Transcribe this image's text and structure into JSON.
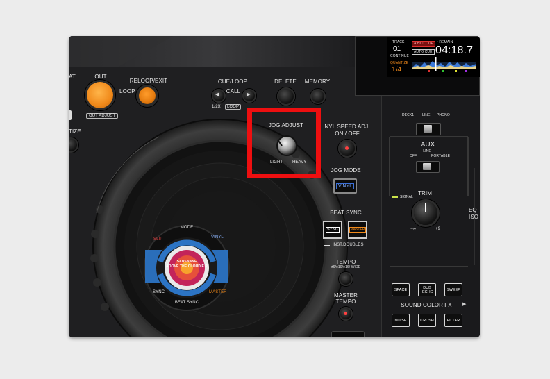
{
  "screen": {
    "track_label": "TRACK",
    "track_no": "01",
    "continue_label": "CONTINUE",
    "hot_cue_badge": "A.HOT CUE",
    "auto_cue_badge": "AUTO CUE",
    "remain_label": "• REMAIN",
    "time": "04:18.7",
    "quantize_label": "QUANTIZE",
    "quantize_value": "1/4"
  },
  "left": {
    "in_label": "AT",
    "out_label": "OUT",
    "loop_label": "LOOP",
    "out_adjust": "OUT ADJUST",
    "reloop_exit": "RELOOP/EXIT",
    "quantize_partial": "TIZE"
  },
  "cue_loop": {
    "title": "CUE/LOOP",
    "call": "CALL",
    "half_x": "1/2X",
    "loop_badge": "LOOP",
    "delete": "DELETE",
    "memory": "MEMORY"
  },
  "jog_adjust": {
    "title": "JOG ADJUST",
    "light": "LIGHT",
    "heavy": "HEAVY"
  },
  "vinyl_speed": {
    "title_line1": "NYL SPEED ADJ.",
    "title_line2": "ON / OFF"
  },
  "jog_mode": {
    "title": "JOG MODE",
    "vinyl_button": "VINYL"
  },
  "beat_sync": {
    "title": "BEAT SYNC",
    "sync_button": "SYNC",
    "master_button": "MASTER",
    "inst_doubles": "INST.DOUBLES"
  },
  "tempo": {
    "title": "TEMPO",
    "ranges": "±6/±10/±16/ WIDE"
  },
  "master_tempo": {
    "line1": "MASTER",
    "line2": "TEMPO"
  },
  "jog_center": {
    "mode": "MODE",
    "slip": "SLIP",
    "vinyl": "VINYL",
    "sync": "SYNC",
    "beat_sync": "BEAT SYNC",
    "master": "MASTER",
    "artist": "SANSNANE",
    "album": "ADOVE THE CLOUD E.P"
  },
  "input_select": {
    "deck1": "DECK1",
    "line": "LINE",
    "phono": "PHONO"
  },
  "aux": {
    "title": "AUX",
    "line": "LINE",
    "off": "OFF",
    "portable": "PORTABLE"
  },
  "trim": {
    "title": "TRIM",
    "signal": "SIGNAL",
    "min": "−∞",
    "max": "+9"
  },
  "eq_partial": {
    "line1": "EQ",
    "line2": "ISO"
  },
  "sound_color_fx": {
    "title": "SOUND COLOR FX",
    "space": "SPACE",
    "dub_echo": "DUB ECHO",
    "sweep": "SWEEP",
    "noise": "NOISE",
    "crush": "CRUSH",
    "filter": "FILTER"
  },
  "colors": {
    "highlight": "#ee0f10",
    "orange": "#f0891a",
    "jog_blue": "#2c74c4",
    "vinyl_blue": "#3a6fd8"
  }
}
